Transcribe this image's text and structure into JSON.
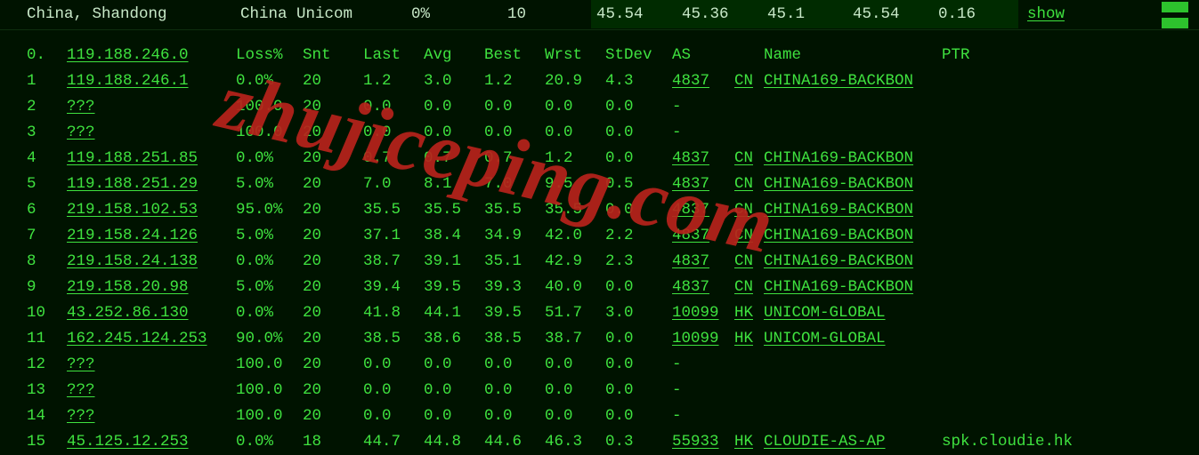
{
  "status": {
    "location": "China, Shandong",
    "isp": "China Unicom",
    "pct": "0%",
    "count": "10",
    "a": "45.54",
    "b": "45.36",
    "c": "45.1",
    "d": "45.54",
    "e": "0.16",
    "show": "show"
  },
  "headers": {
    "hop": "0.",
    "ip": "119.188.246.0",
    "loss": "Loss%",
    "snt": "Snt",
    "last": "Last",
    "avg": "Avg",
    "best": "Best",
    "wrst": "Wrst",
    "stdev": "StDev",
    "as": "AS",
    "name": "Name",
    "ptr": "PTR"
  },
  "rows": [
    {
      "hop": "1",
      "ip": "119.188.246.1",
      "loss": "0.0%",
      "snt": "20",
      "last": "1.2",
      "avg": "3.0",
      "best": "1.2",
      "wrst": "20.9",
      "stdev": "4.3",
      "asn": "4837",
      "cc": "CN",
      "asname": "CHINA169-BACKBON",
      "ptr": ""
    },
    {
      "hop": "2",
      "ip": "???",
      "loss": "100.0",
      "snt": "20",
      "last": "0.0",
      "avg": "0.0",
      "best": "0.0",
      "wrst": "0.0",
      "stdev": "0.0",
      "asn": "-",
      "cc": "",
      "asname": "",
      "ptr": ""
    },
    {
      "hop": "3",
      "ip": "???",
      "loss": "100.0",
      "snt": "20",
      "last": "0.0",
      "avg": "0.0",
      "best": "0.0",
      "wrst": "0.0",
      "stdev": "0.0",
      "asn": "-",
      "cc": "",
      "asname": "",
      "ptr": ""
    },
    {
      "hop": "4",
      "ip": "119.188.251.85",
      "loss": "0.0%",
      "snt": "20",
      "last": "0.7",
      "avg": "0.7",
      "best": "0.7",
      "wrst": "1.2",
      "stdev": "0.0",
      "asn": "4837",
      "cc": "CN",
      "asname": "CHINA169-BACKBON",
      "ptr": ""
    },
    {
      "hop": "5",
      "ip": "119.188.251.29",
      "loss": "5.0%",
      "snt": "20",
      "last": "7.0",
      "avg": "8.1",
      "best": "7.0",
      "wrst": "9.5",
      "stdev": "0.5",
      "asn": "4837",
      "cc": "CN",
      "asname": "CHINA169-BACKBON",
      "ptr": ""
    },
    {
      "hop": "6",
      "ip": "219.158.102.53",
      "loss": "95.0%",
      "snt": "20",
      "last": "35.5",
      "avg": "35.5",
      "best": "35.5",
      "wrst": "35.5",
      "stdev": "0.0",
      "asn": "4837",
      "cc": "CN",
      "asname": "CHINA169-BACKBON",
      "ptr": ""
    },
    {
      "hop": "7",
      "ip": "219.158.24.126",
      "loss": "5.0%",
      "snt": "20",
      "last": "37.1",
      "avg": "38.4",
      "best": "34.9",
      "wrst": "42.0",
      "stdev": "2.2",
      "asn": "4837",
      "cc": "CN",
      "asname": "CHINA169-BACKBON",
      "ptr": ""
    },
    {
      "hop": "8",
      "ip": "219.158.24.138",
      "loss": "0.0%",
      "snt": "20",
      "last": "38.7",
      "avg": "39.1",
      "best": "35.1",
      "wrst": "42.9",
      "stdev": "2.3",
      "asn": "4837",
      "cc": "CN",
      "asname": "CHINA169-BACKBON",
      "ptr": ""
    },
    {
      "hop": "9",
      "ip": "219.158.20.98",
      "loss": "5.0%",
      "snt": "20",
      "last": "39.4",
      "avg": "39.5",
      "best": "39.3",
      "wrst": "40.0",
      "stdev": "0.0",
      "asn": "4837",
      "cc": "CN",
      "asname": "CHINA169-BACKBON",
      "ptr": ""
    },
    {
      "hop": "10",
      "ip": "43.252.86.130",
      "loss": "0.0%",
      "snt": "20",
      "last": "41.8",
      "avg": "44.1",
      "best": "39.5",
      "wrst": "51.7",
      "stdev": "3.0",
      "asn": "10099",
      "cc": "HK",
      "asname": "UNICOM-GLOBAL",
      "ptr": ""
    },
    {
      "hop": "11",
      "ip": "162.245.124.253",
      "loss": "90.0%",
      "snt": "20",
      "last": "38.5",
      "avg": "38.6",
      "best": "38.5",
      "wrst": "38.7",
      "stdev": "0.0",
      "asn": "10099",
      "cc": "HK",
      "asname": "UNICOM-GLOBAL",
      "ptr": ""
    },
    {
      "hop": "12",
      "ip": "???",
      "loss": "100.0",
      "snt": "20",
      "last": "0.0",
      "avg": "0.0",
      "best": "0.0",
      "wrst": "0.0",
      "stdev": "0.0",
      "asn": "-",
      "cc": "",
      "asname": "",
      "ptr": ""
    },
    {
      "hop": "13",
      "ip": "???",
      "loss": "100.0",
      "snt": "20",
      "last": "0.0",
      "avg": "0.0",
      "best": "0.0",
      "wrst": "0.0",
      "stdev": "0.0",
      "asn": "-",
      "cc": "",
      "asname": "",
      "ptr": ""
    },
    {
      "hop": "14",
      "ip": "???",
      "loss": "100.0",
      "snt": "20",
      "last": "0.0",
      "avg": "0.0",
      "best": "0.0",
      "wrst": "0.0",
      "stdev": "0.0",
      "asn": "-",
      "cc": "",
      "asname": "",
      "ptr": ""
    },
    {
      "hop": "15",
      "ip": "45.125.12.253",
      "loss": "0.0%",
      "snt": "18",
      "last": "44.7",
      "avg": "44.8",
      "best": "44.6",
      "wrst": "46.3",
      "stdev": "0.3",
      "asn": "55933",
      "cc": "HK",
      "asname": "CLOUDIE-AS-AP",
      "ptr": "spk.cloudie.hk"
    }
  ],
  "watermark": "zhujiceping.com"
}
